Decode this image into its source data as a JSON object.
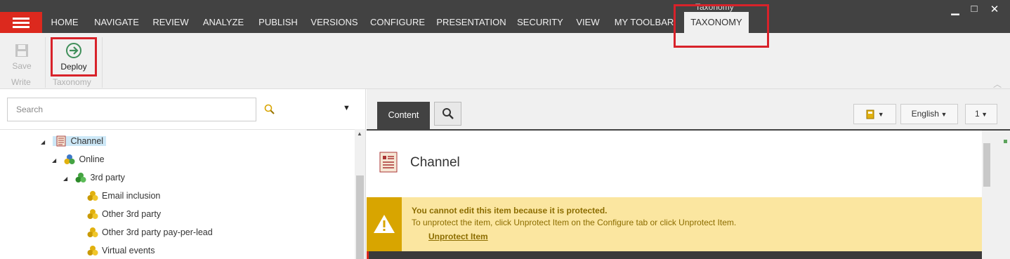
{
  "menubar": {
    "tabs": [
      "HOME",
      "NAVIGATE",
      "REVIEW",
      "ANALYZE",
      "PUBLISH",
      "VERSIONS",
      "CONFIGURE",
      "PRESENTATION",
      "SECURITY",
      "VIEW",
      "MY TOOLBAR",
      "TAXONOMY"
    ],
    "active_tab": "TAXONOMY",
    "contextual_label": "Taxonomy",
    "window_controls": {
      "minimize": "▁",
      "maximize": "□",
      "close": "✕"
    }
  },
  "ribbon": {
    "save_label": "Save",
    "write_group": "Write",
    "deploy_label": "Deploy",
    "taxonomy_group": "Taxonomy"
  },
  "left": {
    "search_placeholder": "Search",
    "tree": [
      {
        "label": "Channel",
        "selected": true,
        "icon": "document-icon"
      },
      {
        "label": "Online",
        "icon": "taxonomy-node-icon"
      },
      {
        "label": "3rd party",
        "icon": "taxonomy-group-icon"
      },
      {
        "label": "Email inclusion",
        "icon": "taxonomy-leaf-icon"
      },
      {
        "label": "Other 3rd party",
        "icon": "taxonomy-leaf-icon"
      },
      {
        "label": "Other 3rd party pay-per-lead",
        "icon": "taxonomy-leaf-icon"
      },
      {
        "label": "Virtual events",
        "icon": "taxonomy-leaf-icon"
      }
    ]
  },
  "right": {
    "content_tab": "Content",
    "language": "English",
    "version": "1",
    "item_title": "Channel",
    "warning": {
      "title": "You cannot edit this item because it is protected.",
      "text": "To unprotect the item, click Unprotect Item on the Configure tab or click Unprotect Item.",
      "link": "Unprotect Item"
    }
  },
  "colors": {
    "menubar_bg": "#424242",
    "accent_red": "#dc291e",
    "warning_bg": "#fbe6a0",
    "warning_side": "#d8a500",
    "highlight": "#d8222a"
  }
}
